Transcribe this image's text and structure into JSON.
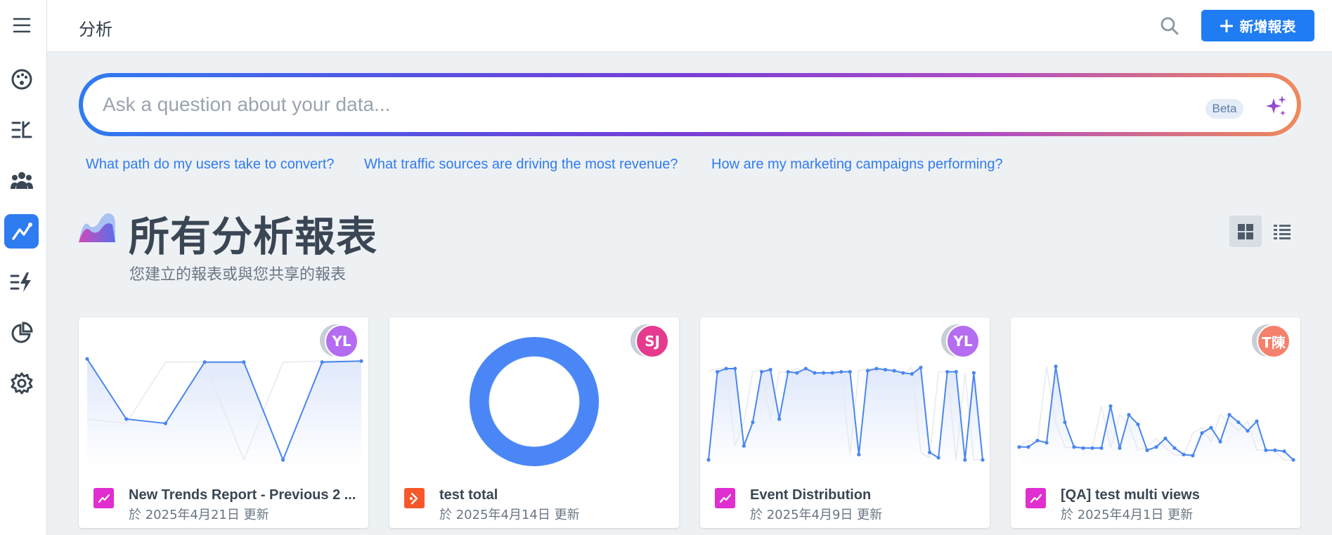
{
  "header": {
    "title": "分析",
    "new_button_label": "新增報表"
  },
  "sidebar": {
    "items": [
      {
        "icon": "menu-icon"
      },
      {
        "icon": "palette-icon"
      },
      {
        "icon": "flows-icon"
      },
      {
        "icon": "users-icon"
      },
      {
        "icon": "analytics-trend-icon",
        "active": true
      },
      {
        "icon": "bolt-list-icon"
      },
      {
        "icon": "pie-icon"
      },
      {
        "icon": "gear-icon"
      }
    ]
  },
  "ask": {
    "placeholder": "Ask a question about your data...",
    "badge": "Beta"
  },
  "suggestions": [
    "What path do my users take to convert?",
    "What traffic sources are driving the most revenue?",
    "How are my marketing campaigns performing?"
  ],
  "section": {
    "title": "所有分析報表",
    "subtitle": "您建立的報表或與您共享的報表"
  },
  "colors": {
    "accent": "#2f7bf0",
    "line": "#4a86ee",
    "trend_icon": "#e02ecf",
    "funnel_icon": "#f6582a"
  },
  "cards": [
    {
      "title": "New Trends Report - Previous 2 ...",
      "date": "於 2025年4月21日 更新",
      "avatar": {
        "initials": "YL",
        "color": "#b46cf0"
      },
      "type": "trend",
      "chart_data": {
        "type": "line",
        "values": [
          0.94,
          0.38,
          0.34,
          0.91,
          0.91,
          0.0,
          0.91,
          0.92
        ]
      }
    },
    {
      "title": "test total",
      "date": "於 2025年4月14日 更新",
      "avatar": {
        "initials": "SJ",
        "color": "#e63a8f"
      },
      "type": "funnel",
      "chart_data": {
        "type": "pie",
        "values": [
          1
        ]
      }
    },
    {
      "title": "Event Distribution",
      "date": "於 2025年4月9日 更新",
      "avatar": {
        "initials": "YL",
        "color": "#b46cf0"
      },
      "type": "trend",
      "chart_data": {
        "type": "line",
        "values": [
          0.0,
          0.82,
          0.85,
          0.85,
          0.13,
          0.35,
          0.82,
          0.84,
          0.38,
          0.82,
          0.81,
          0.85,
          0.81,
          0.81,
          0.81,
          0.82,
          0.82,
          0.05,
          0.83,
          0.85,
          0.84,
          0.83,
          0.81,
          0.8,
          0.86,
          0.07,
          0.02,
          0.82,
          0.82,
          0.0,
          0.81,
          0.0
        ]
      }
    },
    {
      "title": "[QA] test multi views",
      "date": "於 2025年4月1日 更新",
      "avatar": {
        "initials": "T陳",
        "color": "#f5806c"
      },
      "type": "trend",
      "chart_data": {
        "type": "line",
        "values": [
          0.12,
          0.12,
          0.18,
          0.16,
          0.87,
          0.35,
          0.12,
          0.11,
          0.11,
          0.11,
          0.5,
          0.11,
          0.42,
          0.33,
          0.09,
          0.12,
          0.2,
          0.11,
          0.05,
          0.04,
          0.25,
          0.3,
          0.17,
          0.42,
          0.35,
          0.27,
          0.36,
          0.09,
          0.09,
          0.08,
          0.0
        ]
      }
    }
  ]
}
